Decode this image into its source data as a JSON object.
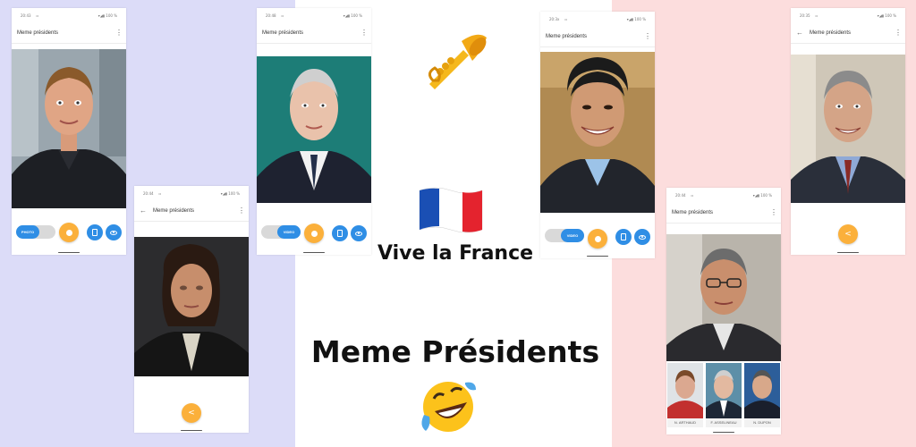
{
  "colors": {
    "band_left": "#dcdcf8",
    "band_middle": "#ffffff",
    "band_right": "#fcdddd",
    "accent_blue": "#2f8ee5",
    "fab_orange": "#fbb03b"
  },
  "hero": {
    "tagline": "Vive la France",
    "title": "Meme Présidents",
    "icons": [
      "trumpet-emoji",
      "france-flag-emoji",
      "rolling-laughing-emoji"
    ]
  },
  "phones": [
    {
      "time": "20:43",
      "app_title": "Meme présidents",
      "more_glyph": "⋮",
      "toggle_label": "PHOTO",
      "battery": "100 %"
    },
    {
      "time": "20:44",
      "app_title": "Meme présidents",
      "more_glyph": "⋮",
      "back_glyph": "←",
      "share_glyph": "<",
      "battery": "100 %"
    },
    {
      "time": "20:48",
      "app_title": "Meme présidents",
      "more_glyph": "⋮",
      "toggle_label": "VIDEO",
      "battery": "100 %"
    },
    {
      "time": "20:3x",
      "app_title": "Meme présidents",
      "more_glyph": "⋮",
      "toggle_label": "VIDEO",
      "battery": "100 %"
    },
    {
      "time": "20:44",
      "app_title": "Meme présidents",
      "more_glyph": "⋮",
      "battery": "100 %",
      "thumbs": [
        "N. ARTHAUD",
        "F. ASSELINEAU",
        "N. DUPON"
      ]
    },
    {
      "time": "20:35",
      "app_title": "Meme présidents",
      "more_glyph": "⋮",
      "back_glyph": "←",
      "share_glyph": "<",
      "battery": "100 %"
    }
  ]
}
